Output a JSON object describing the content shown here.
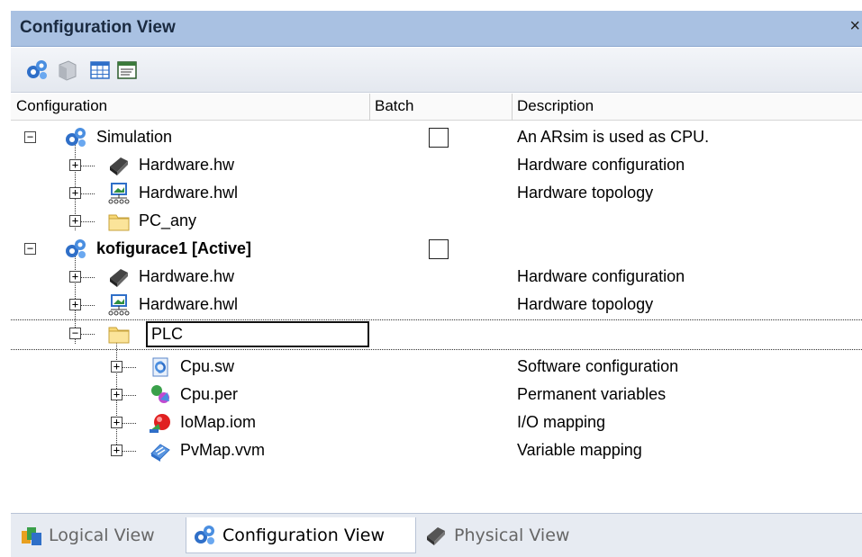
{
  "window": {
    "title": "Configuration View",
    "close_glyph": "×"
  },
  "toolbar": {
    "buttons": [
      {
        "icon": "config-gear-icon"
      },
      {
        "icon": "box-icon"
      },
      {
        "icon": "table-icon"
      },
      {
        "icon": "list-window-icon"
      }
    ]
  },
  "columns": {
    "configuration": "Configuration",
    "batch": "Batch",
    "description": "Description"
  },
  "tree": {
    "simulation": {
      "label": "Simulation",
      "description": "An ARsim is used as CPU.",
      "expander": "−"
    },
    "sim_hw": {
      "label": "Hardware.hw",
      "description": "Hardware configuration",
      "expander": "+"
    },
    "sim_hwl": {
      "label": "Hardware.hwl",
      "description": "Hardware topology",
      "expander": "+"
    },
    "sim_pc": {
      "label": "PC_any",
      "description": "",
      "expander": "+"
    },
    "kof": {
      "label": "kofigurace1 [Active]",
      "description": "",
      "expander": "−"
    },
    "kof_hw": {
      "label": "Hardware.hw",
      "description": "Hardware configuration",
      "expander": "+"
    },
    "kof_hwl": {
      "label": "Hardware.hwl",
      "description": "Hardware topology",
      "expander": "+"
    },
    "plc": {
      "label": "PLC",
      "description": "",
      "expander": "−"
    },
    "cpu_sw": {
      "label": "Cpu.sw",
      "description": "Software configuration",
      "expander": "+"
    },
    "cpu_per": {
      "label": "Cpu.per",
      "description": "Permanent variables",
      "expander": "+"
    },
    "iomap": {
      "label": "IoMap.iom",
      "description": "I/O mapping",
      "expander": "+"
    },
    "pvmap": {
      "label": "PvMap.vvm",
      "description": "Variable mapping",
      "expander": "+"
    }
  },
  "tabs": [
    {
      "label": "Logical View",
      "active": false
    },
    {
      "label": "Configuration View",
      "active": true
    },
    {
      "label": "Physical View",
      "active": false
    }
  ],
  "colors": {
    "title_bar": "#a9c1e2",
    "config_blue": "#2f6fc8"
  }
}
